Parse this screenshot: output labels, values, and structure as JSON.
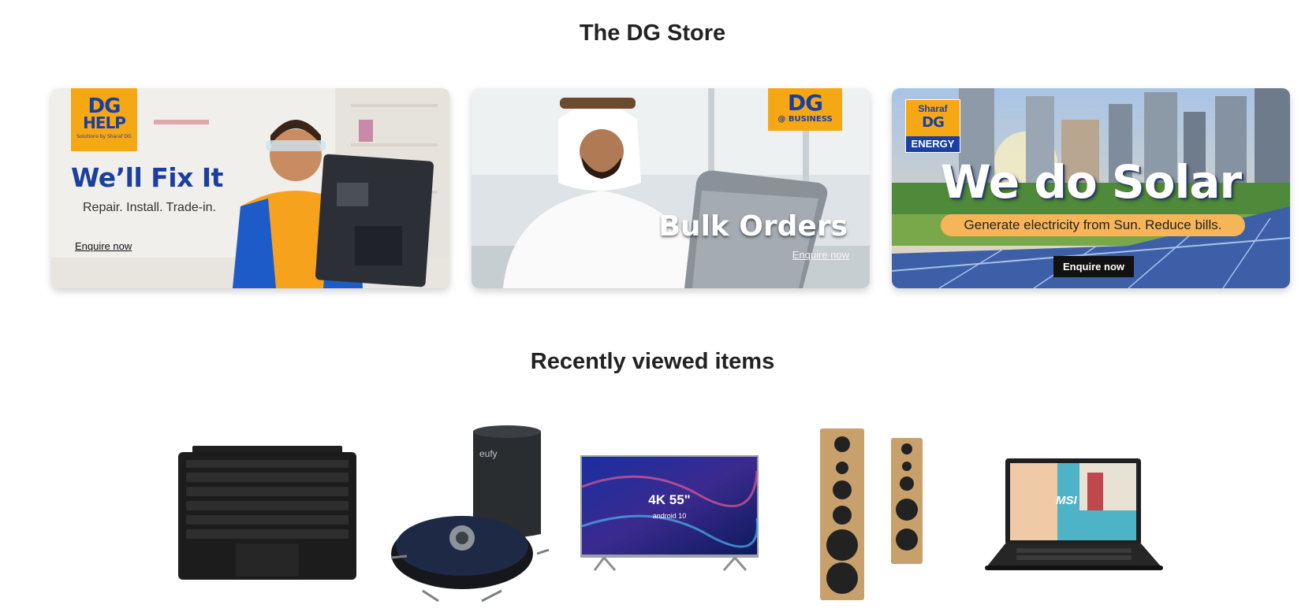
{
  "store": {
    "title": "The DG Store"
  },
  "banners": {
    "fix": {
      "logo_line1": "DG",
      "logo_line2": "HELP",
      "logo_tagline": "Solutions by Sharaf DG",
      "headline": "We’ll Fix It",
      "subtitle": "Repair. Install. Trade-in.",
      "link": "Enquire now"
    },
    "bulk": {
      "logo_line1": "DG",
      "logo_line2": "@ BUSINESS",
      "headline": "Bulk Orders",
      "link": "Enquire now"
    },
    "solar": {
      "logo_line1": "Sharaf",
      "logo_line2": "DG",
      "logo_line3": "ENERGY",
      "headline": "We do Solar",
      "subtitle": "Generate electricity from Sun. Reduce bills.",
      "button": "Enquire now"
    }
  },
  "recent": {
    "title": "Recently viewed items",
    "items": [
      {
        "name": "keyboard-cover",
        "icon": "keyboard-icon"
      },
      {
        "name": "robot-vacuum",
        "icon": "robot-vacuum-icon",
        "brand": "eufy"
      },
      {
        "name": "television",
        "icon": "tv-icon",
        "badge": "4K 55\"",
        "os": "android 10"
      },
      {
        "name": "tower-speakers",
        "icon": "speaker-icon"
      },
      {
        "name": "laptop",
        "icon": "laptop-icon",
        "brand": "MSI"
      }
    ]
  }
}
